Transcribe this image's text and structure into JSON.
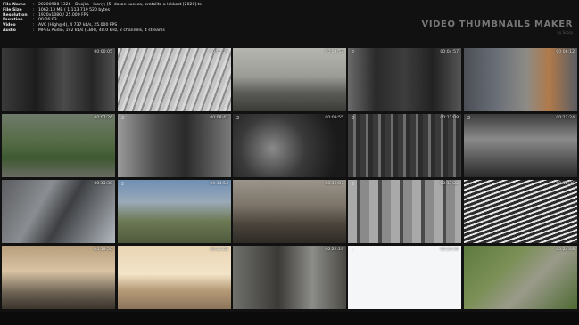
{
  "file_info": [
    {
      "label": "File Name",
      "value": "20200908 1326 - Dvojka - Ikony; [5] dosan kuceca, bratalita a lakkost [2020].ts"
    },
    {
      "label": "File Size",
      "value": "1062.13 MB  ( 1 113 719 520  bytes"
    },
    {
      "label": "Resolution",
      "value": "1920x1080 / 25.000 FPS"
    },
    {
      "label": "Duration",
      "value": "00:26:03"
    },
    {
      "label": "Video",
      "value": "AVC (High@4), 4 737 kb/s, 25.000 FPS"
    },
    {
      "label": "Audio",
      "value": "MPEG Audio, 192 kb/s (CBR), 48.0 kHz, 2 channels, 4 streams"
    }
  ],
  "brand": {
    "title": "VIDEO THUMBNAILS MAKER",
    "subtitle": "by Scorp"
  },
  "tiles": [
    {
      "num": "",
      "time": "00:00:05"
    },
    {
      "num": "",
      "time": "00:02:26"
    },
    {
      "num": "",
      "time": "00:03:53"
    },
    {
      "num": "2",
      "time": "00:04:57"
    },
    {
      "num": "",
      "time": "00:06:12"
    },
    {
      "num": "",
      "time": "00:07:26"
    },
    {
      "num": "2",
      "time": "00:08:41"
    },
    {
      "num": "2",
      "time": "00:09:55"
    },
    {
      "num": "2",
      "time": "00:11:09"
    },
    {
      "num": "2",
      "time": "00:12:24"
    },
    {
      "num": "",
      "time": "00:13:38"
    },
    {
      "num": "2",
      "time": "00:14:53"
    },
    {
      "num": "",
      "time": "00:16:07"
    },
    {
      "num": "2",
      "time": "00:17:22"
    },
    {
      "num": "",
      "time": "00:18:36"
    },
    {
      "num": "",
      "time": "00:19:50"
    },
    {
      "num": "",
      "time": "00:21:05"
    },
    {
      "num": "",
      "time": "00:22:19"
    },
    {
      "num": "2",
      "time": "00:23:34"
    },
    {
      "num": "",
      "time": "00:24:48"
    }
  ]
}
